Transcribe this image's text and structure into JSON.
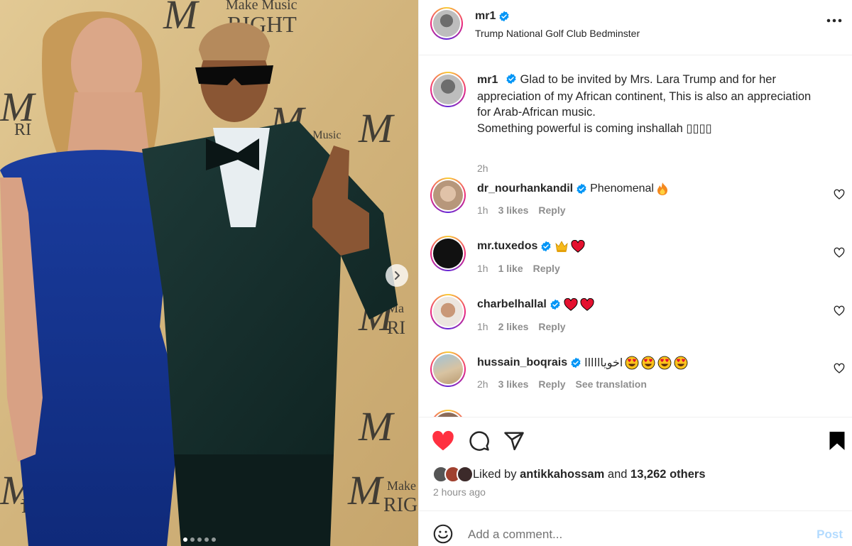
{
  "photo": {
    "alt_text_backdrop": "Make Music RIGHT",
    "backdrop_words": [
      "Make Music",
      "RIGHT",
      "Make",
      "RI",
      "M"
    ],
    "carousel": {
      "count": 5,
      "active_index": 0
    }
  },
  "post": {
    "author": "mr1",
    "location": "Trump National Golf Club Bedminster",
    "caption": {
      "username": "mr1",
      "text_lines": [
        "Glad to be invited by Mrs. Lara Trump and for her",
        "appreciation of my African continent, This is also an appreciation",
        "for Arab-African music.",
        "Something powerful is coming inshallah ▯▯▯▯"
      ],
      "time": "2h"
    },
    "comments": [
      {
        "username": "dr_nourhankandil",
        "text": "Phenomenal",
        "emojis": [
          "fire"
        ],
        "time": "1h",
        "likes": "3 likes",
        "reply": "Reply",
        "avatar_color": "#caa889"
      },
      {
        "username": "mr.tuxedos",
        "text": "",
        "emojis": [
          "crown",
          "heart"
        ],
        "time": "1h",
        "likes": "1 like",
        "reply": "Reply",
        "avatar_color": "#111111"
      },
      {
        "username": "charbelhallal",
        "text": "",
        "emojis": [
          "heart",
          "heart"
        ],
        "time": "1h",
        "likes": "2 likes",
        "reply": "Reply",
        "avatar_color": "#e8e2dc"
      },
      {
        "username": "hussain_boqrais",
        "text": "اخوياااااا",
        "emojis": [
          "heart-eyes",
          "heart-eyes",
          "heart-eyes",
          "heart-eyes"
        ],
        "time": "2h",
        "likes": "3 likes",
        "reply": "Reply",
        "translation": "See translation",
        "avatar_color": "#b9a88c"
      }
    ],
    "liked_by": {
      "prefix": "Liked by",
      "user": "antikkahossam",
      "and": "and",
      "others": "13,262 others"
    },
    "posted": "2 hours ago",
    "comment_placeholder": "Add a comment...",
    "post_label": "Post"
  },
  "colors": {
    "verified": "#0095f6",
    "like_red": "#ff3040",
    "text": "#262626",
    "secondary": "#8e8e8e",
    "post_disabled": "#b3dbff"
  }
}
